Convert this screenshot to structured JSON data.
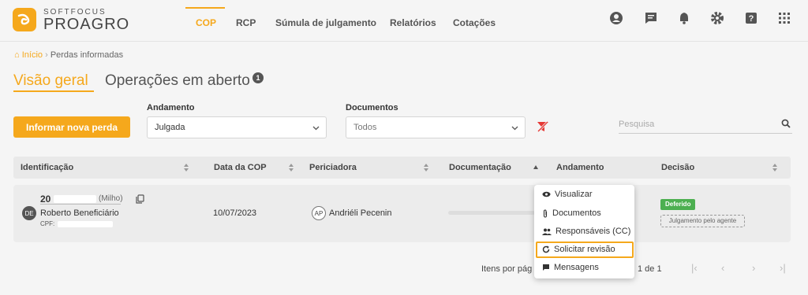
{
  "brand": {
    "small": "SOFTFOCUS",
    "big": "PROAGRO",
    "accent": "#f5a81c"
  },
  "nav": {
    "items": [
      "COP",
      "RCP",
      "Súmula de julgamento",
      "Relatórios",
      "Cotações"
    ],
    "active": "COP"
  },
  "top_icons": [
    "account-icon",
    "chat-icon",
    "bell-icon",
    "gear-icon",
    "help-icon",
    "apps-grid-icon"
  ],
  "breadcrumb": {
    "home": "Início",
    "current": "Perdas informadas"
  },
  "tabs": {
    "overview": "Visão geral",
    "open": "Operações em aberto",
    "open_count": "1"
  },
  "filters": {
    "andamento_label": "Andamento",
    "andamento_value": "Julgada",
    "documentos_label": "Documentos",
    "documentos_value": "Todos",
    "search_placeholder": "Pesquisa"
  },
  "actions": {
    "new_loss": "Informar nova perda"
  },
  "table": {
    "headers": [
      "Identificação",
      "Data da COP",
      "Periciadora",
      "Documentação",
      "Andamento",
      "Decisão"
    ],
    "row": {
      "id_number": "20",
      "crop": "(Milho)",
      "avatar_initials": "DE",
      "beneficiary": "Roberto Beneficiário",
      "cpf_label": "CPF:",
      "date": "10/07/2023",
      "expert_initials": "AP",
      "expert_name": "Andriéli Pecenin",
      "decision": "Deferido",
      "decision_note": "Julgamento pelo agente"
    }
  },
  "context_menu": {
    "items": [
      "Visualizar",
      "Documentos",
      "Responsáveis (CC)",
      "Solicitar revisão",
      "Mensagens"
    ],
    "highlighted": "Solicitar revisão"
  },
  "pagination": {
    "label": "Itens por pág",
    "count": "1 de 1"
  }
}
